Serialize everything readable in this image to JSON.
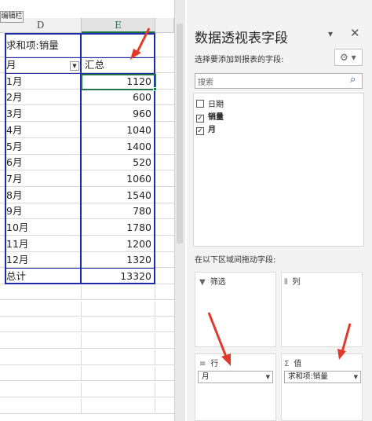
{
  "formula_bar": {
    "name_box_label": "编辑栏"
  },
  "columns": [
    "D",
    "E"
  ],
  "pivot": {
    "title": "求和项:销量",
    "row_header": "月",
    "value_header": "汇总",
    "rows": [
      {
        "label": "1月",
        "value": "1120"
      },
      {
        "label": "2月",
        "value": "600"
      },
      {
        "label": "3月",
        "value": "960"
      },
      {
        "label": "4月",
        "value": "1040"
      },
      {
        "label": "5月",
        "value": "1400"
      },
      {
        "label": "6月",
        "value": "520"
      },
      {
        "label": "7月",
        "value": "1060"
      },
      {
        "label": "8月",
        "value": "1540"
      },
      {
        "label": "9月",
        "value": "780"
      },
      {
        "label": "10月",
        "value": "1780"
      },
      {
        "label": "11月",
        "value": "1200"
      },
      {
        "label": "12月",
        "value": "1320"
      }
    ],
    "total_label": "总计",
    "total_value": "13320"
  },
  "panel": {
    "title": "数据透视表字段",
    "subtitle": "选择要添加到报表的字段:",
    "search_placeholder": "搜索",
    "fields": [
      {
        "label": "日期",
        "checked": false
      },
      {
        "label": "销量",
        "checked": true
      },
      {
        "label": "月",
        "checked": true
      }
    ],
    "areas_label": "在以下区域间拖动字段:",
    "areas": {
      "filter": {
        "title": "筛选"
      },
      "columns": {
        "title": "列"
      },
      "rows": {
        "title": "行",
        "chip": "月"
      },
      "values": {
        "title": "值",
        "chip": "求和项:销量"
      }
    }
  },
  "colors": {
    "pivot_border": "#1f2aa8",
    "selection": "#217346",
    "arrow": "#e23a2a"
  }
}
